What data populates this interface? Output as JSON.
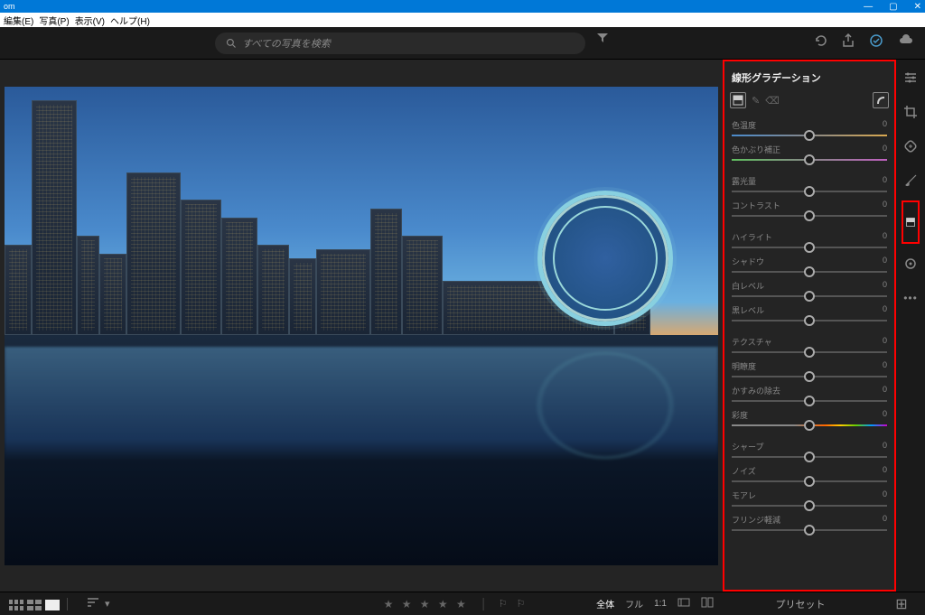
{
  "window": {
    "title_suffix": "om",
    "min": "—",
    "max": "▢",
    "close": "✕"
  },
  "menu": {
    "edit": "編集(E)",
    "photo": "写真(P)",
    "view": "表示(V)",
    "help": "ヘルプ(H)"
  },
  "search": {
    "placeholder": "すべての写真を検索"
  },
  "panel": {
    "title": "線形グラデーション",
    "sliders": [
      {
        "group": 0,
        "label": "色温度",
        "value": "0",
        "track": "temp",
        "pos": 50
      },
      {
        "group": 0,
        "label": "色かぶり補正",
        "value": "0",
        "track": "tint",
        "pos": 50
      },
      {
        "group": 1,
        "label": "露光量",
        "value": "0",
        "track": "",
        "pos": 50
      },
      {
        "group": 1,
        "label": "コントラスト",
        "value": "0",
        "track": "",
        "pos": 50
      },
      {
        "group": 2,
        "label": "ハイライト",
        "value": "0",
        "track": "",
        "pos": 50
      },
      {
        "group": 2,
        "label": "シャドウ",
        "value": "0",
        "track": "",
        "pos": 50
      },
      {
        "group": 2,
        "label": "白レベル",
        "value": "0",
        "track": "",
        "pos": 50
      },
      {
        "group": 2,
        "label": "黒レベル",
        "value": "0",
        "track": "",
        "pos": 50
      },
      {
        "group": 3,
        "label": "テクスチャ",
        "value": "0",
        "track": "",
        "pos": 50
      },
      {
        "group": 3,
        "label": "明瞭度",
        "value": "0",
        "track": "",
        "pos": 50
      },
      {
        "group": 3,
        "label": "かすみの除去",
        "value": "0",
        "track": "",
        "pos": 50
      },
      {
        "group": 3,
        "label": "彩度",
        "value": "0",
        "track": "sat",
        "pos": 50
      },
      {
        "group": 4,
        "label": "シャープ",
        "value": "0",
        "track": "",
        "pos": 50
      },
      {
        "group": 4,
        "label": "ノイズ",
        "value": "0",
        "track": "",
        "pos": 50
      },
      {
        "group": 4,
        "label": "モアレ",
        "value": "0",
        "track": "",
        "pos": 50
      },
      {
        "group": 4,
        "label": "フリンジ軽減",
        "value": "0",
        "track": "",
        "pos": 50
      }
    ]
  },
  "bottom": {
    "zoom_full": "全体",
    "zoom_fill": "フル",
    "zoom_11": "1:1",
    "preset": "プリセット",
    "stars": "★ ★ ★ ★ ★"
  },
  "icons": {
    "filter": "▾",
    "undo": "↶",
    "share": "⇪",
    "sync": "✓",
    "cloud": "☁",
    "preset_toggle": "⊞"
  }
}
